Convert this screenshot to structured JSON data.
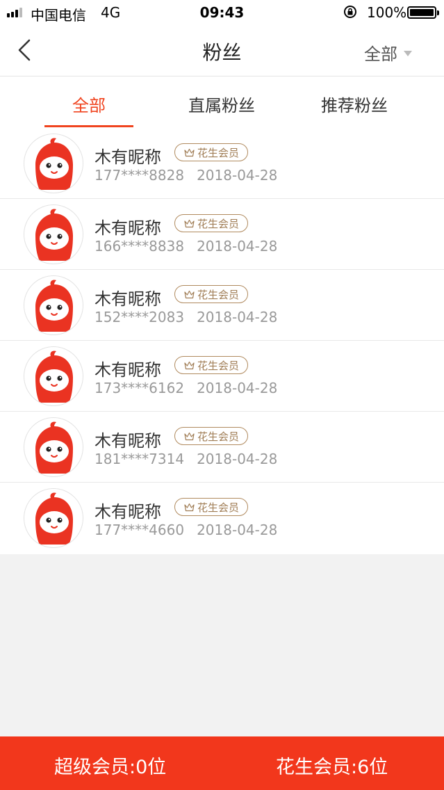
{
  "status_bar": {
    "carrier": "中国电信",
    "network": "4G",
    "time": "09:43",
    "battery": "100%"
  },
  "nav": {
    "title": "粉丝",
    "filter_label": "全部"
  },
  "tabs": [
    {
      "label": "全部",
      "active": true
    },
    {
      "label": "直属粉丝",
      "active": false
    },
    {
      "label": "推荐粉丝",
      "active": false
    }
  ],
  "fans": [
    {
      "name": "木有昵称",
      "badge": "花生会员",
      "phone": "177****8828",
      "date": "2018-04-28"
    },
    {
      "name": "木有昵称",
      "badge": "花生会员",
      "phone": "166****8838",
      "date": "2018-04-28"
    },
    {
      "name": "木有昵称",
      "badge": "花生会员",
      "phone": "152****2083",
      "date": "2018-04-28"
    },
    {
      "name": "木有昵称",
      "badge": "花生会员",
      "phone": "173****6162",
      "date": "2018-04-28"
    },
    {
      "name": "木有昵称",
      "badge": "花生会员",
      "phone": "181****7314",
      "date": "2018-04-28"
    },
    {
      "name": "木有昵称",
      "badge": "花生会员",
      "phone": "177****4660",
      "date": "2018-04-28"
    }
  ],
  "footer": {
    "super_members": "超级会员:0位",
    "peanut_members": "花生会员:6位"
  },
  "colors": {
    "accent": "#f0441f",
    "footer": "#f2371c",
    "badge": "#b08a5e"
  }
}
